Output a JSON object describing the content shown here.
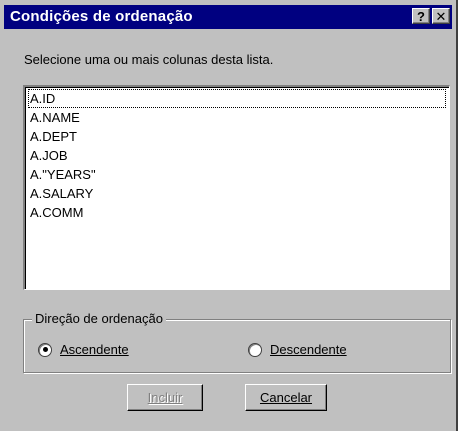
{
  "dialog": {
    "title": "Condições de ordenação",
    "help_glyph": "?",
    "close_glyph": "✕"
  },
  "prompt": "Selecione uma ou mais colunas desta lista.",
  "columns": [
    "A.ID",
    "A.NAME",
    "A.DEPT",
    "A.JOB",
    "A.\"YEARS\"",
    "A.SALARY",
    "A.COMM"
  ],
  "sort_direction": {
    "legend": "Direção de ordenação",
    "ascending_label": "Ascendente",
    "descending_label": "Descendente",
    "selected": "Ascendente"
  },
  "buttons": {
    "include_label": "Incluir",
    "include_enabled": false,
    "cancel_label": "Cancelar"
  }
}
